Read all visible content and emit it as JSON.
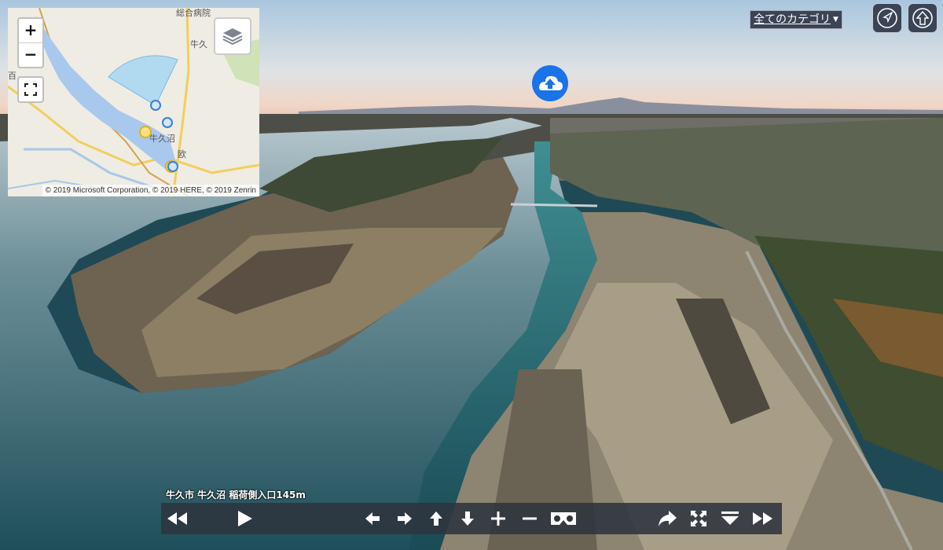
{
  "minimap": {
    "zoom_in": "+",
    "zoom_out": "−",
    "label_hospital": "総合病院",
    "label_ushiku_top": "牛久",
    "label_ushikunuma": "牛久沼",
    "label_kanji": "欧",
    "label_left": "百",
    "attribution": "© 2019 Microsoft Corporation, © 2019 HERE, © 2019 Zenrin",
    "icons": {
      "fullscreen": "fullscreen-icon",
      "layers": "layers-icon"
    }
  },
  "category": {
    "label": "全てのカテゴリ",
    "arrow": "▼"
  },
  "top_buttons": {
    "navigate": "navigate-icon",
    "up": "up-arrow-icon"
  },
  "scene": {
    "location": "牛久市 牛久沼 稲荷側入口145m"
  },
  "toolbar": {
    "icons": [
      "rewind-icon",
      "play-icon",
      "pan-left-icon",
      "pan-right-icon",
      "pan-up-icon",
      "pan-down-icon",
      "zoom-in-icon",
      "zoom-out-icon",
      "vr-cardboard-icon",
      "share-icon",
      "fullscreen-icon",
      "menu-down-icon",
      "fast-forward-icon"
    ]
  },
  "colors": {
    "accent": "#1a73e8",
    "toolbar_bg": "#2d343e",
    "button_bg": "#3a4455"
  }
}
